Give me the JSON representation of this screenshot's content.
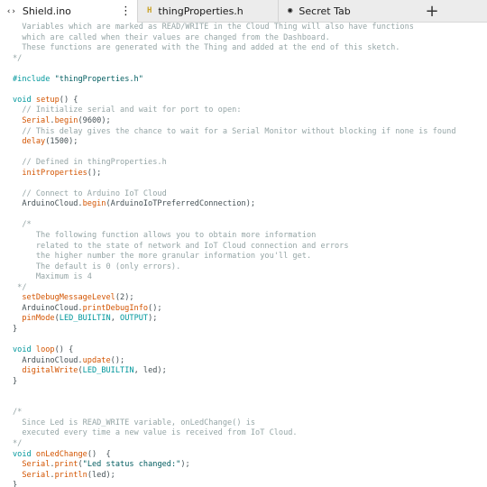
{
  "tabs": [
    {
      "icon": "‹›",
      "label": "Shield.ino",
      "menu": "⋮",
      "active": true
    },
    {
      "icon": "H",
      "label": "thingProperties.h",
      "active": false
    },
    {
      "icon": "◉",
      "label": "Secret Tab",
      "active": false
    }
  ],
  "new_tab_label": "+",
  "code_lines": [
    [
      [
        "cm",
        "  Variables which are marked as READ/WRITE in the Cloud Thing will also have functions"
      ]
    ],
    [
      [
        "cm",
        "  which are called when their values are changed from the Dashboard."
      ]
    ],
    [
      [
        "cm",
        "  These functions are generated with the Thing and added at the end of this sketch."
      ]
    ],
    [
      [
        "cm",
        "*/"
      ]
    ],
    [],
    [
      [
        "kw",
        "#include"
      ],
      [
        "tx",
        " "
      ],
      [
        "st",
        "\"thingProperties.h\""
      ]
    ],
    [],
    [
      [
        "kw",
        "void"
      ],
      [
        "tx",
        " "
      ],
      [
        "fn",
        "setup"
      ],
      [
        "tx",
        "() {"
      ]
    ],
    [
      [
        "cm",
        "  // Initialize serial and wait for port to open:"
      ]
    ],
    [
      [
        "tx",
        "  "
      ],
      [
        "fn",
        "Serial"
      ],
      [
        "tx",
        "."
      ],
      [
        "fn",
        "begin"
      ],
      [
        "tx",
        "(9600);"
      ]
    ],
    [
      [
        "cm",
        "  // This delay gives the chance to wait for a Serial Monitor without blocking if none is found"
      ]
    ],
    [
      [
        "tx",
        "  "
      ],
      [
        "fn",
        "delay"
      ],
      [
        "tx",
        "(1500);"
      ]
    ],
    [],
    [
      [
        "cm",
        "  // Defined in thingProperties.h"
      ]
    ],
    [
      [
        "tx",
        "  "
      ],
      [
        "fn",
        "initProperties"
      ],
      [
        "tx",
        "();"
      ]
    ],
    [],
    [
      [
        "cm",
        "  // Connect to Arduino IoT Cloud"
      ]
    ],
    [
      [
        "tx",
        "  ArduinoCloud."
      ],
      [
        "fn",
        "begin"
      ],
      [
        "tx",
        "(ArduinoIoTPreferredConnection);"
      ]
    ],
    [],
    [
      [
        "cm",
        "  /*"
      ]
    ],
    [
      [
        "cm",
        "     The following function allows you to obtain more information"
      ]
    ],
    [
      [
        "cm",
        "     related to the state of network and IoT Cloud connection and errors"
      ]
    ],
    [
      [
        "cm",
        "     the higher number the more granular information you'll get."
      ]
    ],
    [
      [
        "cm",
        "     The default is 0 (only errors)."
      ]
    ],
    [
      [
        "cm",
        "     Maximum is 4"
      ]
    ],
    [
      [
        "cm",
        " */"
      ]
    ],
    [
      [
        "tx",
        "  "
      ],
      [
        "fn",
        "setDebugMessageLevel"
      ],
      [
        "tx",
        "(2);"
      ]
    ],
    [
      [
        "tx",
        "  ArduinoCloud."
      ],
      [
        "fn",
        "printDebugInfo"
      ],
      [
        "tx",
        "();"
      ]
    ],
    [
      [
        "tx",
        "  "
      ],
      [
        "fn",
        "pinMode"
      ],
      [
        "tx",
        "("
      ],
      [
        "cn",
        "LED_BUILTIN"
      ],
      [
        "tx",
        ", "
      ],
      [
        "cn",
        "OUTPUT"
      ],
      [
        "tx",
        ");"
      ]
    ],
    [
      [
        "tx",
        "}"
      ]
    ],
    [],
    [
      [
        "kw",
        "void"
      ],
      [
        "tx",
        " "
      ],
      [
        "fn",
        "loop"
      ],
      [
        "tx",
        "() {"
      ]
    ],
    [
      [
        "tx",
        "  ArduinoCloud."
      ],
      [
        "fn",
        "update"
      ],
      [
        "tx",
        "();"
      ]
    ],
    [
      [
        "tx",
        "  "
      ],
      [
        "fn",
        "digitalWrite"
      ],
      [
        "tx",
        "("
      ],
      [
        "cn",
        "LED_BUILTIN"
      ],
      [
        "tx",
        ", led);"
      ]
    ],
    [
      [
        "tx",
        "}"
      ]
    ],
    [],
    [],
    [
      [
        "cm",
        "/*"
      ]
    ],
    [
      [
        "cm",
        "  Since Led is READ_WRITE variable, onLedChange() is"
      ]
    ],
    [
      [
        "cm",
        "  executed every time a new value is received from IoT Cloud."
      ]
    ],
    [
      [
        "cm",
        "*/"
      ]
    ],
    [
      [
        "kw",
        "void"
      ],
      [
        "tx",
        " "
      ],
      [
        "fn",
        "onLedChange"
      ],
      [
        "tx",
        "()  {"
      ]
    ],
    [
      [
        "tx",
        "  "
      ],
      [
        "fn",
        "Serial"
      ],
      [
        "tx",
        "."
      ],
      [
        "fn",
        "print"
      ],
      [
        "tx",
        "("
      ],
      [
        "st",
        "\"Led status changed:\""
      ],
      [
        "tx",
        ");"
      ]
    ],
    [
      [
        "tx",
        "  "
      ],
      [
        "fn",
        "Serial"
      ],
      [
        "tx",
        "."
      ],
      [
        "fn",
        "println"
      ],
      [
        "tx",
        "(led);"
      ]
    ],
    [
      [
        "tx",
        "}"
      ]
    ]
  ]
}
